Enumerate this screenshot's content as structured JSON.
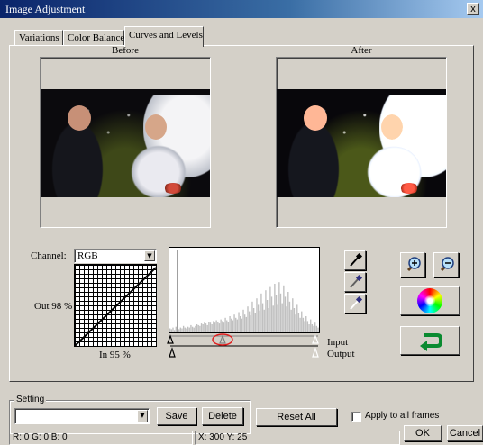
{
  "window": {
    "title": "Image Adjustment",
    "close": "x"
  },
  "tabs": [
    {
      "label": "Variations"
    },
    {
      "label": "Color Balance"
    },
    {
      "label": "Curves and Levels"
    }
  ],
  "preview": {
    "before_label": "Before",
    "after_label": "After"
  },
  "curves": {
    "channel_label": "Channel:",
    "channel_value": "RGB",
    "out_label": "Out 98 %",
    "in_label": "In   95 %"
  },
  "levels": {
    "input_label": "Input",
    "output_label": "Output",
    "histogram": [
      5,
      4,
      6,
      3,
      7,
      5,
      4,
      6,
      5,
      8,
      6,
      5,
      7,
      6,
      9,
      7,
      6,
      8,
      10,
      9,
      8,
      11,
      10,
      12,
      11,
      9,
      13,
      12,
      10,
      14,
      12,
      15,
      13,
      11,
      16,
      14,
      12,
      18,
      15,
      13,
      20,
      17,
      15,
      22,
      18,
      16,
      25,
      20,
      17,
      28,
      22,
      19,
      32,
      26,
      21,
      38,
      30,
      24,
      42,
      34,
      27,
      48,
      36,
      28,
      52,
      40,
      30,
      56,
      44,
      33,
      60,
      46,
      34,
      62,
      48,
      36,
      58,
      44,
      32,
      50,
      38,
      28,
      42,
      30,
      22,
      34,
      24,
      18,
      26,
      18,
      14,
      20,
      14,
      10,
      16,
      10,
      8,
      12,
      8,
      6
    ]
  },
  "setting": {
    "group_label": "Setting",
    "value": "",
    "save_label": "Save",
    "delete_label": "Delete"
  },
  "reset_label": "Reset All",
  "apply_label": "Apply to all frames",
  "ok_label": "OK",
  "cancel_label": "Cancel",
  "status": {
    "rgb": "R:  0 G:  0 B:  0",
    "xy": "X: 300   Y: 25"
  },
  "colors": {
    "titlebar": "#0a246a",
    "face": "#d4d0c8",
    "marker": "#e02020"
  }
}
